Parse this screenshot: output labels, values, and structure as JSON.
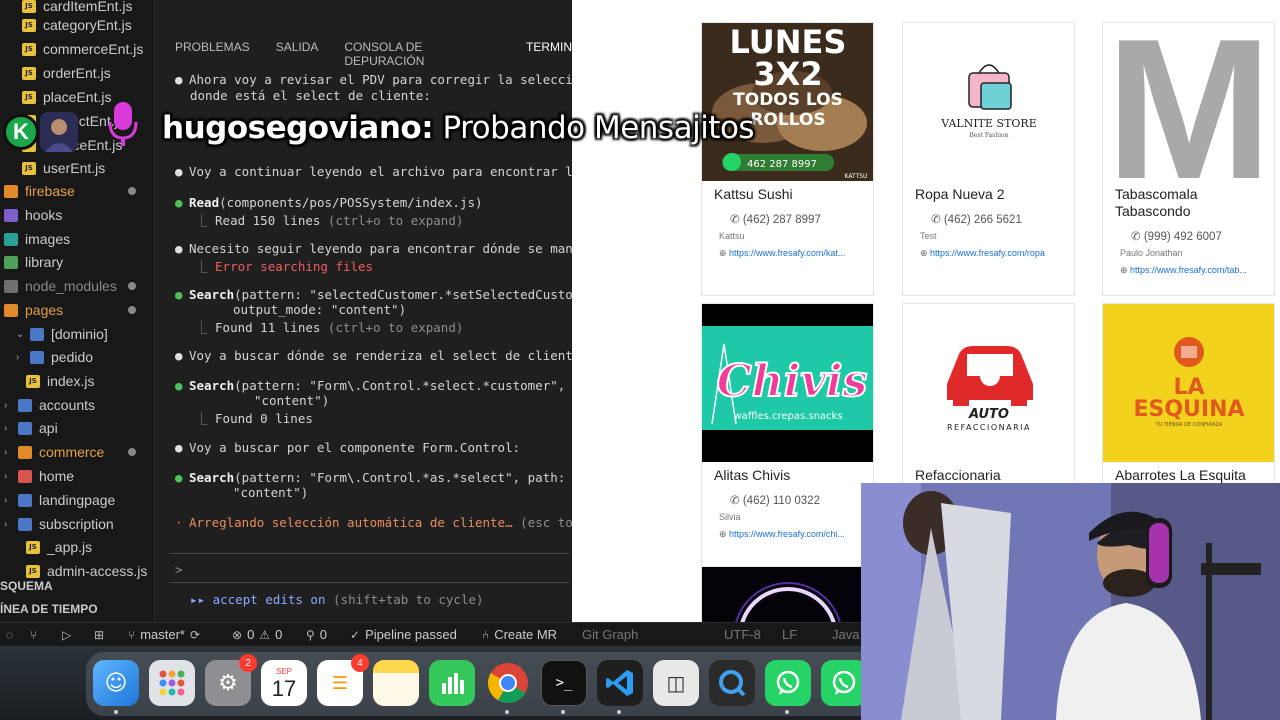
{
  "explorer": {
    "files": [
      {
        "label": "cardItemEnt.js",
        "type": "js"
      },
      {
        "label": "categoryEnt.js",
        "type": "js"
      },
      {
        "label": "commerceEnt.js",
        "type": "js"
      },
      {
        "label": "orderEnt.js",
        "type": "js"
      },
      {
        "label": "placeEnt.js",
        "type": "js"
      },
      {
        "label": "productEnt.js",
        "type": "js"
      },
      {
        "label": "serviceEnt.js",
        "type": "js"
      },
      {
        "label": "userEnt.js",
        "type": "js"
      },
      {
        "label": "firebase",
        "type": "folder"
      },
      {
        "label": "hooks",
        "type": "folder"
      },
      {
        "label": "images",
        "type": "folder"
      },
      {
        "label": "library",
        "type": "folder"
      },
      {
        "label": "node_modules",
        "type": "folder"
      },
      {
        "label": "pages",
        "type": "folder"
      },
      {
        "label": "[dominio]",
        "type": "folder"
      },
      {
        "label": "pedido",
        "type": "folder"
      },
      {
        "label": "index.js",
        "type": "js"
      },
      {
        "label": "accounts",
        "type": "folder"
      },
      {
        "label": "api",
        "type": "folder"
      },
      {
        "label": "commerce",
        "type": "folder"
      },
      {
        "label": "home",
        "type": "folder"
      },
      {
        "label": "landingpage",
        "type": "folder"
      },
      {
        "label": "subscription",
        "type": "folder"
      },
      {
        "label": "_app.js",
        "type": "js"
      },
      {
        "label": "admin-access.js",
        "type": "js"
      }
    ],
    "outline_header": "SQUEMA",
    "timeline_header": "ÍNEA DE TIEMPO"
  },
  "terminal": {
    "tabs": [
      "PROBLEMAS",
      "SALIDA",
      "CONSOLA DE DEPURACIÓN",
      "TERMIN"
    ],
    "lines": {
      "l1a": "Ahora voy a revisar el PDV para corregir la selección",
      "l1b": "donde está el select de cliente:",
      "l2": "Voy a continuar leyendo el archivo para encontrar la",
      "l3_tool": "Read",
      "l3_arg": "(components/pos/POSSystem/index.js)",
      "l3_res": "Read 150 lines",
      "l3_hint": "(ctrl+o to expand)",
      "l4": "Necesito seguir leyendo para encontrar dónde se manej",
      "l4_err": "Error searching files",
      "l5_tool": "Search",
      "l5_arg": "(pattern: \"selectedCustomer.*setSelectedCustome",
      "l5_arg2": "output_mode: \"content\")",
      "l5_res": "Found 11 lines",
      "l5_hint": "(ctrl+o to expand)",
      "l6": "Voy a buscar dónde se renderiza el select de cliente:",
      "l7_tool": "Search",
      "l7_arg": "(pattern: \"Form\\.Control.*select.*customer\", pa",
      "l7_arg2": "\"content\")",
      "l7_res": "Found 0 lines",
      "l8": "Voy a buscar por el componente Form.Control:",
      "l9_tool": "Search",
      "l9_arg": "(pattern: \"Form\\.Control.*as.*select\", path: \"c",
      "l9_arg2": "\"content\")",
      "l10": "Arreglando selección automática de cliente…",
      "l10_hint": "(esc to i",
      "prompt": ">",
      "mode_arrows": "▸▸",
      "mode": "accept edits on",
      "mode_hint": "(shift+tab to cycle)"
    }
  },
  "statusbar": {
    "branch": "master*",
    "errors": "0",
    "warnings": "0",
    "ports": "0",
    "pipeline": "Pipeline passed",
    "create_mr": "Create MR",
    "git_graph": "Git Graph",
    "encoding": "UTF-8",
    "eol": "LF",
    "lang": "Java"
  },
  "chat": {
    "user": "hugosegoviano:",
    "message": "Probando Mensajitos",
    "avatar_letter": "K"
  },
  "stores": [
    {
      "name": "Kattsu Sushi",
      "phone": "(462) 287 8997",
      "owner": "Kattsu",
      "url": "https://www.fresafy.com/kat...",
      "banner": {
        "line1": "LUNES",
        "line2": "3X2",
        "line3": "TODOS LOS",
        "line4": "ROLLOS",
        "phone": "462 287 8997",
        "brand": "KATTSU"
      }
    },
    {
      "name": "Ropa Nueva 2",
      "phone": "(462) 266 5621",
      "owner": "Test",
      "url": "https://www.fresafy.com/ropa",
      "banner": {
        "brand": "VALNITE STORE",
        "sub": "Best Fashion"
      }
    },
    {
      "name": "Tabascomala Tabascondo",
      "phone": "(999) 492 6007",
      "owner": "Paulo Jonathan",
      "url": "https://www.fresafy.com/tab...",
      "banner": {
        "letter": "M"
      }
    },
    {
      "name": "Alitas Chivis",
      "phone": "(462) 110 0322",
      "owner": "Silvia",
      "url": "https://www.fresafy.com/chi...",
      "banner": {
        "brand": "Chivis",
        "sub": "waffles.crepas.snacks"
      }
    },
    {
      "name": "Refaccionaria",
      "banner": {
        "brand": "AUTO",
        "sub": "REFACCIONARIA"
      }
    },
    {
      "name": "Abarrotes La Esquita",
      "banner": {
        "line1": "LA",
        "line2": "ESQUINA",
        "sub": "TU TIENDA DE CONFIANZA"
      }
    }
  ],
  "dock": {
    "calendar_month": "SEP",
    "calendar_day": "17",
    "settings_badge": "2",
    "reminders_badge": "4",
    "terminal_glyph": ">_"
  },
  "colors": {
    "editor_bg": "#1f1f1f",
    "sidebar_bg": "#181818",
    "link": "#1a6fd3",
    "kattsu_bg": "#3a2b1c",
    "chivis_bg": "#1ec9a8",
    "esquina_bg": "#f3d21e",
    "auto_red": "#e02a2a"
  }
}
